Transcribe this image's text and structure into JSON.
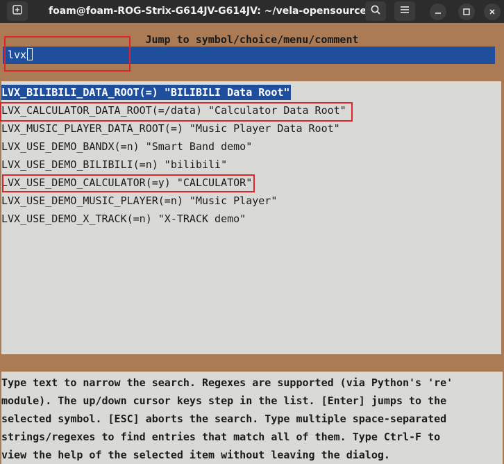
{
  "window": {
    "title": "foam@foam-ROG-Strix-G614JV-G614JV: ~/vela-opensource"
  },
  "dialog": {
    "title": "Jump to symbol/choice/menu/comment",
    "search_value": "lvx"
  },
  "results": [
    "LVX_BILIBILI_DATA_ROOT(=) \"BILIBILI Data Root\"",
    "LVX_CALCULATOR_DATA_ROOT(=/data) \"Calculator Data Root\"",
    "LVX_MUSIC_PLAYER_DATA_ROOT(=) \"Music Player Data Root\"",
    "LVX_USE_DEMO_BANDX(=n) \"Smart Band demo\"",
    "LVX_USE_DEMO_BILIBILI(=n) \"bilibili\"",
    "LVX_USE_DEMO_CALCULATOR(=y) \"CALCULATOR\"",
    "LVX_USE_DEMO_MUSIC_PLAYER(=n) \"Music Player\"",
    "LVX_USE_DEMO_X_TRACK(=n) \"X-TRACK demo\""
  ],
  "help": [
    "Type text to narrow the search. Regexes are supported (via Python's 're'",
    "module). The up/down cursor keys step in the list. [Enter] jumps to the",
    "selected symbol. [ESC] aborts the search. Type multiple space-separated",
    "strings/regexes to find entries that match all of them. Type Ctrl-F to",
    "view the help of the selected item without leaving the dialog."
  ],
  "icons": {
    "new_tab": "new-tab-icon",
    "search": "search-icon",
    "menu": "hamburger-menu-icon",
    "minimize": "minimize-icon",
    "maximize": "maximize-icon",
    "close": "close-icon"
  },
  "colors": {
    "accent_blue": "#1f4f9c",
    "frame_brown": "#aa7b54",
    "panel_gray": "#d9d9d6",
    "highlight_red": "#e0242b"
  }
}
